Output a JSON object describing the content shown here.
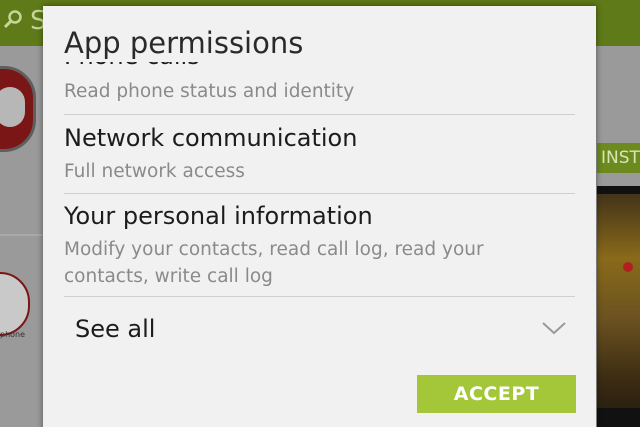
{
  "background": {
    "search_text": "S",
    "install_label": "INST",
    "app_label": "phone",
    "colors": {
      "topbar": "#5f7a18",
      "install_button": "#6c8a1d",
      "app_accent": "#7a1616"
    }
  },
  "dialog": {
    "title": "App permissions",
    "permissions": [
      {
        "heading": "Phone calls",
        "description": "Read phone status and identity"
      },
      {
        "heading": "Network communication",
        "description": "Full network access"
      },
      {
        "heading": "Your personal information",
        "description": "Modify your contacts, read call log, read your contacts, write call log"
      }
    ],
    "see_all_label": "See all",
    "see_all_icon": "chevron-down-icon",
    "accept_label": "ACCEPT",
    "colors": {
      "accept_button": "#a4c639",
      "heading_text": "#1c1c1c",
      "description_text": "#8a8a8a",
      "surface": "#f1f1f1"
    }
  }
}
